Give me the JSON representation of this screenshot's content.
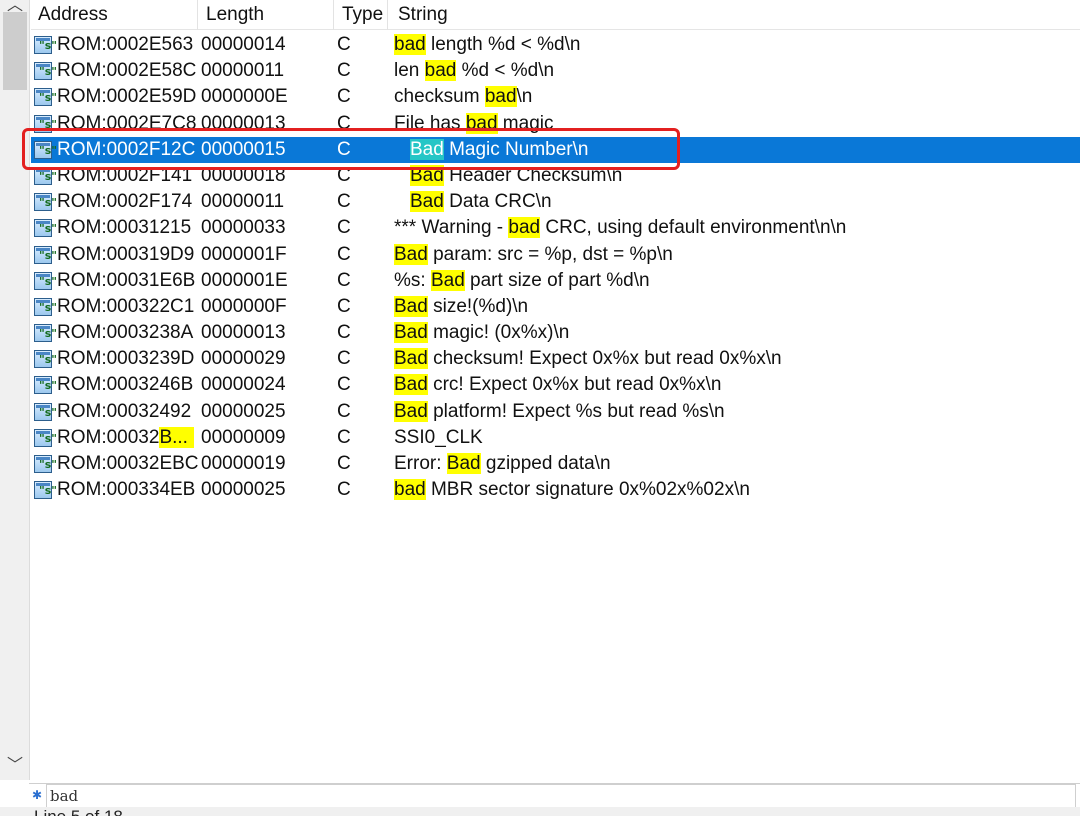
{
  "header": {
    "address": "Address",
    "length": "Length",
    "type": "Type",
    "string": "String"
  },
  "rows": [
    {
      "address": "ROM:0002E563",
      "length": "00000014",
      "type": "C",
      "pre": "",
      "match": "bad",
      "post": " length %d < %d\\n"
    },
    {
      "address": "ROM:0002E58C",
      "length": "00000011",
      "type": "C",
      "pre": "len ",
      "match": "bad",
      "post": " %d < %d\\n"
    },
    {
      "address": "ROM:0002E59D",
      "length": "0000000E",
      "type": "C",
      "pre": "checksum ",
      "match": "bad",
      "post": "\\n"
    },
    {
      "address": "ROM:0002E7C8",
      "length": "00000013",
      "type": "C",
      "pre": "File has ",
      "match": "bad",
      "post": " magic"
    },
    {
      "address": "ROM:0002F12C",
      "length": "00000015",
      "type": "C",
      "pre": "",
      "match": "Bad",
      "post": " Magic Number\\n"
    },
    {
      "address": "ROM:0002F141",
      "length": "00000018",
      "type": "C",
      "pre": "",
      "match": "Bad",
      "post": " Header Checksum\\n"
    },
    {
      "address": "ROM:0002F174",
      "length": "00000011",
      "type": "C",
      "pre": "",
      "match": "Bad",
      "post": " Data CRC\\n"
    },
    {
      "address": "ROM:00031215",
      "length": "00000033",
      "type": "C",
      "pre": "*** Warning - ",
      "match": "bad",
      "post": " CRC, using default environment\\n\\n"
    },
    {
      "address": "ROM:000319D9",
      "length": "0000001F",
      "type": "C",
      "pre": "",
      "match": "Bad",
      "post": " param: src = %p, dst = %p\\n"
    },
    {
      "address": "ROM:00031E6B",
      "length": "0000001E",
      "type": "C",
      "pre": "%s: ",
      "match": "Bad",
      "post": " part size of part %d\\n"
    },
    {
      "address": "ROM:000322C1",
      "length": "0000000F",
      "type": "C",
      "pre": "",
      "match": "Bad",
      "post": " size!(%d)\\n"
    },
    {
      "address": "ROM:0003238A",
      "length": "00000013",
      "type": "C",
      "pre": "",
      "match": "Bad",
      "post": " magic! (0x%x)\\n"
    },
    {
      "address": "ROM:0003239D",
      "length": "00000029",
      "type": "C",
      "pre": "",
      "match": "Bad",
      "post": " checksum! Expect 0x%x but read 0x%x\\n"
    },
    {
      "address": "ROM:0003246B",
      "length": "00000024",
      "type": "C",
      "pre": "",
      "match": "Bad",
      "post": " crc! Expect 0x%x but read 0x%x\\n"
    },
    {
      "address": "ROM:00032492",
      "length": "00000025",
      "type": "C",
      "pre": "",
      "match": "Bad",
      "post": " platform! Expect %s but read %s\\n"
    },
    {
      "address": "ROM:00032B...",
      "length": "00000009",
      "type": "C",
      "pre": "SSI0_CLK",
      "match": "",
      "post": ""
    },
    {
      "address": "ROM:00032EBC",
      "length": "00000019",
      "type": "C",
      "pre": "Error: ",
      "match": "Bad",
      "post": " gzipped data\\n"
    },
    {
      "address": "ROM:000334EB",
      "length": "00000025",
      "type": "C",
      "pre": "",
      "match": "bad",
      "post": " MBR sector signature 0x%02x%02x\\n"
    }
  ],
  "filter": {
    "value": "bad"
  },
  "status": {
    "text": "Line 5 of 18"
  },
  "colors": {
    "selection": "#0a78d7",
    "match_highlight": "#ffff00",
    "selected_match_highlight": "#25c6c6",
    "annotation_box": "#e32020"
  },
  "icons": {
    "row_icon": "string-icon",
    "filter_icon": "filter-icon",
    "scroll_up": "chevron-up-icon",
    "scroll_down": "chevron-down-icon"
  }
}
